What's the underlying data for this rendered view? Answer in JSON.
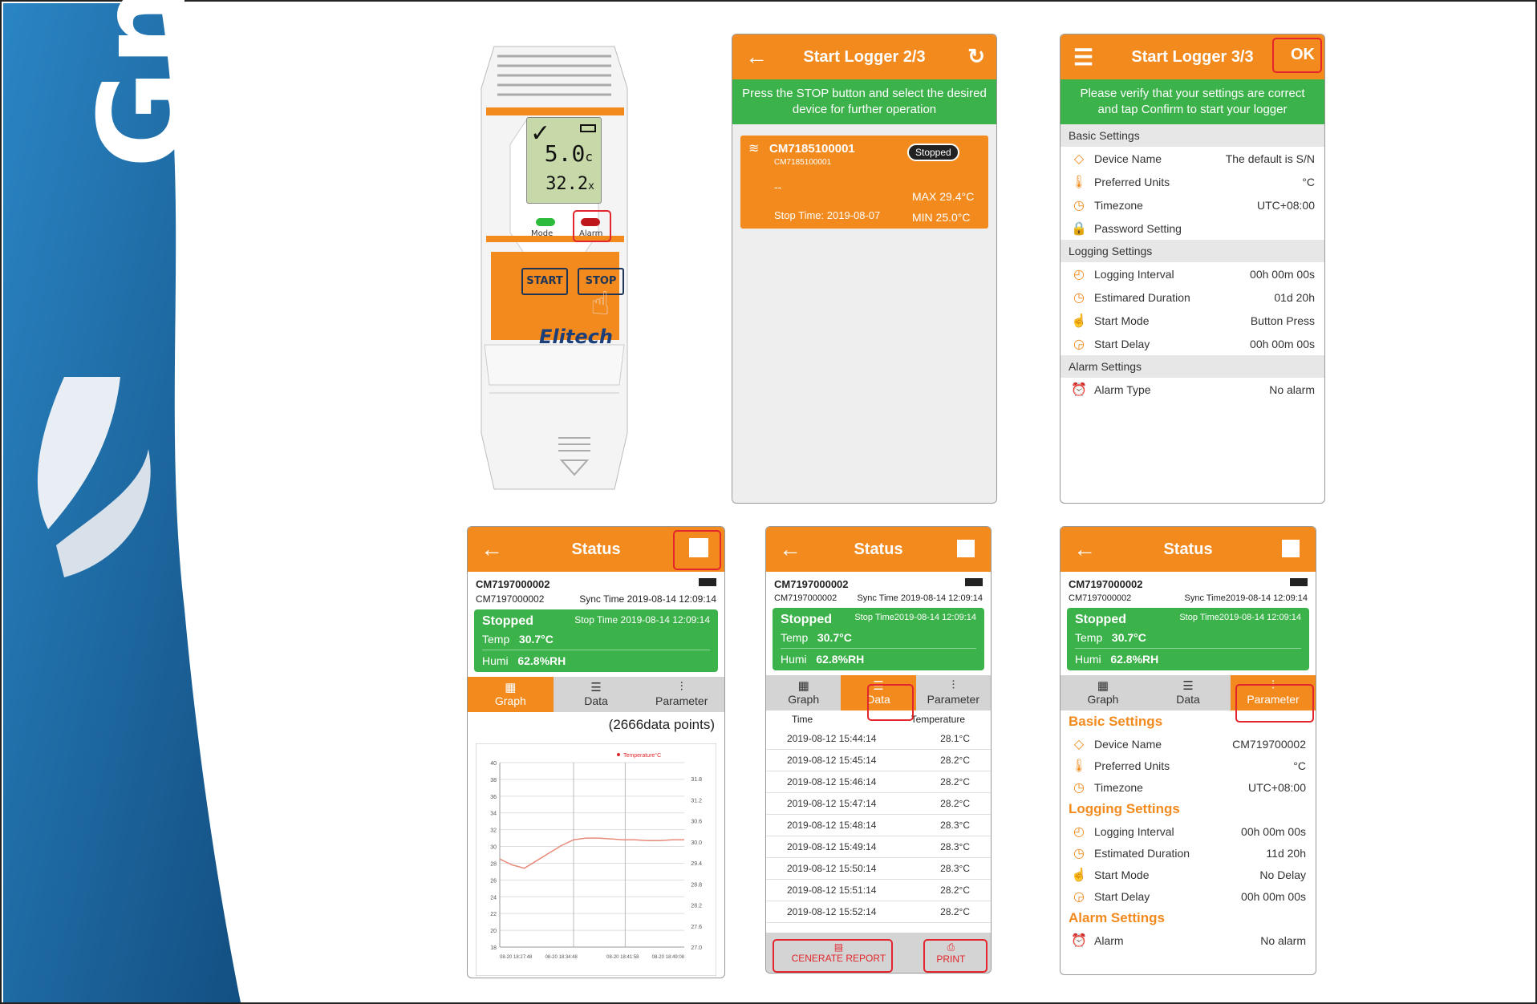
{
  "brand": {
    "logo_text": "Gmm"
  },
  "device": {
    "lcd_value1": "5.0",
    "lcd_unit1": "c",
    "lcd_value2": "32.2",
    "lcd_unit2": "x",
    "mode_label": "Mode",
    "alarm_label": "Alarm",
    "start_label": "START",
    "stop_label": "STOP",
    "brand": "Elitech"
  },
  "logger2": {
    "title": "Start Logger 2/3",
    "instruction": "Press the STOP button and select the desired device for further operation",
    "device_id": "CM7185100001",
    "device_sub": "CM7185100001",
    "status": "Stopped",
    "dash": "--",
    "max": "MAX 29.4°C",
    "min": "MIN 25.0°C",
    "stop_time": "Stop Time: 2019-08-07"
  },
  "logger3": {
    "title": "Start Logger 3/3",
    "ok": "OK",
    "instruction": "Please verify that your settings are correct and tap Confirm to start your logger",
    "basic_header": "Basic Settings",
    "logging_header": "Logging Settings",
    "alarm_header": "Alarm Settings",
    "basic": [
      {
        "icon": "tag-icon",
        "label": "Device Name",
        "value": "The default is S/N"
      },
      {
        "icon": "thermometer-icon",
        "label": "Preferred Units",
        "value": "°C"
      },
      {
        "icon": "clock-icon",
        "label": "Timezone",
        "value": "UTC+08:00"
      },
      {
        "icon": "lock-icon",
        "label": "Password Setting",
        "value": ""
      }
    ],
    "logging": [
      {
        "icon": "timer-icon",
        "label": "Logging Interval",
        "value": "00h 00m 00s"
      },
      {
        "icon": "clock-icon",
        "label": "Estimared Duration",
        "value": "01d 20h"
      },
      {
        "icon": "hand-icon",
        "label": "Start Mode",
        "value": "Button Press"
      },
      {
        "icon": "delay-icon",
        "label": "Start Delay",
        "value": "00h 00m 00s"
      }
    ],
    "alarm": [
      {
        "icon": "alarm-icon",
        "label": "Alarm Type",
        "value": "No alarm"
      }
    ]
  },
  "status_common": {
    "title": "Status",
    "device_id": "CM7197000002",
    "device_sub": "CM7197000002",
    "stopped": "Stopped",
    "temp_label": "Temp",
    "temp_value": "30.7°C",
    "humi_label": "Humi",
    "humi_value": "62.8%RH",
    "tab_graph": "Graph",
    "tab_data": "Data",
    "tab_param": "Parameter"
  },
  "status1": {
    "sync": "Sync Time 2019-08-14 12:09:14",
    "stop": "Stop Time 2019-08-14 12:09:14",
    "points": "(2666data points)",
    "legend": "Temperature°C"
  },
  "status2": {
    "sync": "Sync Time 2019-08-14 12:09:14",
    "stop": "Stop Time2019-08-14 12:09:14",
    "col_time": "Time",
    "col_temp": "Temperature",
    "rows": [
      [
        "2019-08-12 15:44:14",
        "28.1°C"
      ],
      [
        "2019-08-12 15:45:14",
        "28.2°C"
      ],
      [
        "2019-08-12 15:46:14",
        "28.2°C"
      ],
      [
        "2019-08-12 15:47:14",
        "28.2°C"
      ],
      [
        "2019-08-12 15:48:14",
        "28.3°C"
      ],
      [
        "2019-08-12 15:49:14",
        "28.3°C"
      ],
      [
        "2019-08-12 15:50:14",
        "28.3°C"
      ],
      [
        "2019-08-12 15:51:14",
        "28.2°C"
      ],
      [
        "2019-08-12 15:52:14",
        "28.2°C"
      ]
    ],
    "report": "CENERATE REPORT",
    "print": "PRINT"
  },
  "status3": {
    "sync": "Sync Time2019-08-14 12:09:14",
    "stop": "Stop Time2019-08-14 12:09:14",
    "basic_header": "Basic Settings",
    "logging_header": "Logging Settings",
    "alarm_header": "Alarm Settings",
    "basic": [
      {
        "icon": "tag-icon",
        "label": "Device Name",
        "value": "CM719700002"
      },
      {
        "icon": "thermometer-icon",
        "label": "Preferred Units",
        "value": "°C"
      },
      {
        "icon": "clock-icon",
        "label": "Timezone",
        "value": "UTC+08:00"
      }
    ],
    "logging": [
      {
        "icon": "timer-icon",
        "label": "Logging Interval",
        "value": "00h 00m 00s"
      },
      {
        "icon": "clock-icon",
        "label": "Estimated Duration",
        "value": "11d 20h"
      },
      {
        "icon": "hand-icon",
        "label": "Start Mode",
        "value": "No Delay"
      },
      {
        "icon": "delay-icon",
        "label": "Start Delay",
        "value": "00h 00m 00s"
      }
    ],
    "alarm": [
      {
        "icon": "alarm-icon",
        "label": "Alarm",
        "value": "No alarm"
      }
    ]
  },
  "chart_data": {
    "type": "line",
    "title": "",
    "series": [
      {
        "name": "Temperature°C",
        "values": [
          28.5,
          27.8,
          27.4,
          28.3,
          29.2,
          30.1,
          30.8,
          31.0,
          31.0,
          30.9,
          30.8,
          30.8,
          30.7,
          30.7,
          30.8,
          30.8
        ]
      }
    ],
    "y_left_ticks": [
      "40",
      "38",
      "36",
      "34",
      "32",
      "30",
      "28",
      "26",
      "24",
      "22",
      "20",
      "18"
    ],
    "y_right_ticks": [
      "31.8",
      "31.2",
      "30.6",
      "30.0",
      "29.4",
      "28.8",
      "28.2",
      "27.6",
      "27.0"
    ],
    "x_ticks": [
      "08-20 18:27:48",
      "08-20 18:34:48",
      "08-20 18:41:58",
      "08-20 18:49:08"
    ],
    "ylim": [
      18,
      40
    ]
  },
  "colors": {
    "orange": "#f28a1e",
    "green": "#3cb24a",
    "red": "#e3262b",
    "brand_blue": "#1d6aa3"
  }
}
